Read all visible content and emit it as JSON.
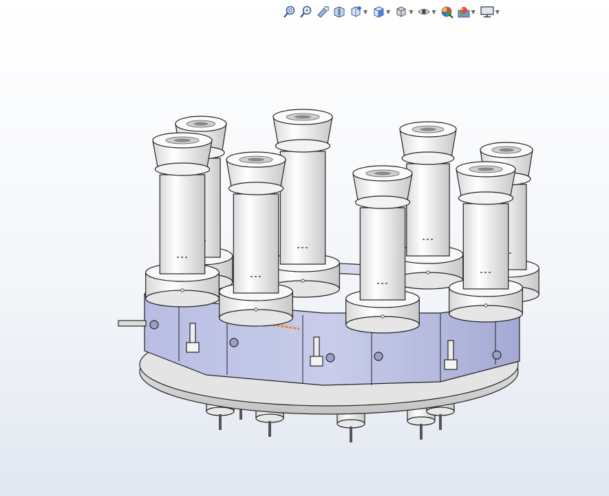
{
  "toolbar": {
    "buttons": [
      {
        "name": "zoom-to-fit-icon",
        "has_dropdown": false
      },
      {
        "name": "zoom-to-area-icon",
        "has_dropdown": false
      },
      {
        "name": "previous-view-icon",
        "has_dropdown": false
      },
      {
        "name": "section-view-icon",
        "has_dropdown": false
      },
      {
        "name": "dynamic-annotation-icon",
        "has_dropdown": true
      },
      {
        "name": "view-orientation-icon",
        "has_dropdown": true
      },
      {
        "name": "display-style-icon",
        "has_dropdown": true
      },
      {
        "name": "hide-show-items-icon",
        "has_dropdown": true
      },
      {
        "name": "edit-appearance-icon",
        "has_dropdown": false
      },
      {
        "name": "apply-scene-icon",
        "has_dropdown": true
      },
      {
        "name": "view-settings-icon",
        "has_dropdown": true
      }
    ]
  },
  "model": {
    "description_icon": "cad-assembly-eight-cylinder-ring",
    "colors": {
      "body_white": "#f7f7f7",
      "body_shade": "#dcdcdc",
      "base_blue": "#c9cdea",
      "base_blue_dark": "#a9aed8",
      "edge": "#222222",
      "highlight_orange": "#e8891d",
      "base_plate": "#e4e4e4"
    }
  }
}
